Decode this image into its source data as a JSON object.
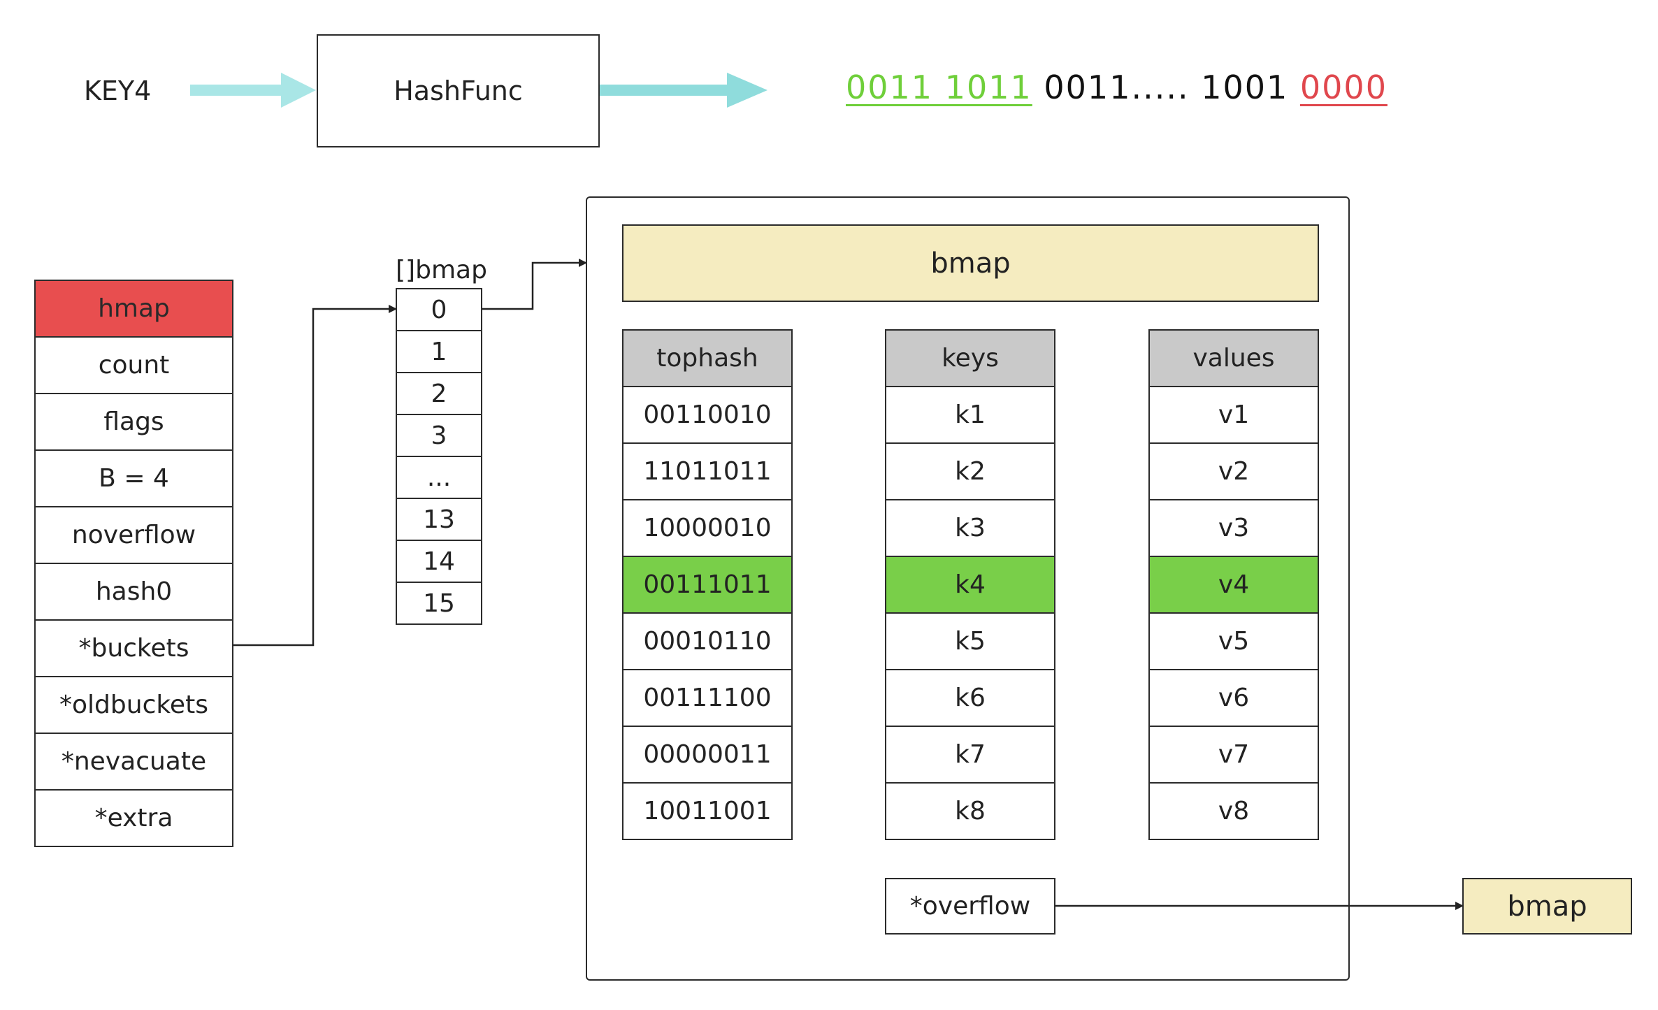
{
  "key_label": "KEY4",
  "hash_func_label": "HashFunc",
  "hash_output": {
    "top_bits": "0011 1011",
    "middle_bits": "0011..... 1001",
    "low_bits": "0000"
  },
  "hmap": {
    "title": "hmap",
    "fields": [
      "count",
      "flags",
      "B = 4",
      "noverflow",
      "hash0",
      "*buckets",
      "*oldbuckets",
      "*nevacuate",
      "*extra"
    ]
  },
  "buckets_array": {
    "label": "[]bmap",
    "indices": [
      "0",
      "1",
      "2",
      "3",
      "...",
      "13",
      "14",
      "15"
    ]
  },
  "bucket": {
    "title": "bmap",
    "tophash": {
      "header": "tophash",
      "values": [
        "00110010",
        "11011011",
        "10000010",
        "00111011",
        "00010110",
        "00111100",
        "00000011",
        "10011001"
      ]
    },
    "keys": {
      "header": "keys",
      "values": [
        "k1",
        "k2",
        "k3",
        "k4",
        "k5",
        "k6",
        "k7",
        "k8"
      ]
    },
    "values": {
      "header": "values",
      "values": [
        "v1",
        "v2",
        "v3",
        "v4",
        "v5",
        "v6",
        "v7",
        "v8"
      ]
    },
    "highlight_row": 3,
    "overflow_label": "*overflow"
  },
  "overflow_bucket_label": "bmap",
  "colors": {
    "hmap_header": "#e84e4f",
    "bucket_header": "#f5ecc0",
    "column_header": "#c9c9c9",
    "highlight": "#79cf49",
    "cyan_arrow": "#8fdcdc",
    "hash_green": "#6fcf3a",
    "hash_red": "#e0474d"
  }
}
